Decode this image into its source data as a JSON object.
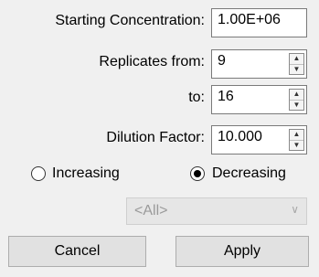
{
  "labels": {
    "starting_concentration": "Starting Concentration:",
    "replicates_from": "Replicates from:",
    "to": "to:",
    "dilution_factor": "Dilution Factor:"
  },
  "inputs": {
    "starting_concentration": "1.00E+06",
    "replicates_from": "9",
    "replicates_to": "16",
    "dilution_factor": "10.000"
  },
  "order": {
    "increasing_label": "Increasing",
    "decreasing_label": "Decreasing",
    "selected": "Decreasing"
  },
  "filter": {
    "selected": "<All>",
    "enabled": false
  },
  "buttons": {
    "cancel": "Cancel",
    "apply": "Apply"
  },
  "icons": {
    "spin_up": "▲",
    "spin_down": "▼",
    "dropdown": "∨"
  }
}
